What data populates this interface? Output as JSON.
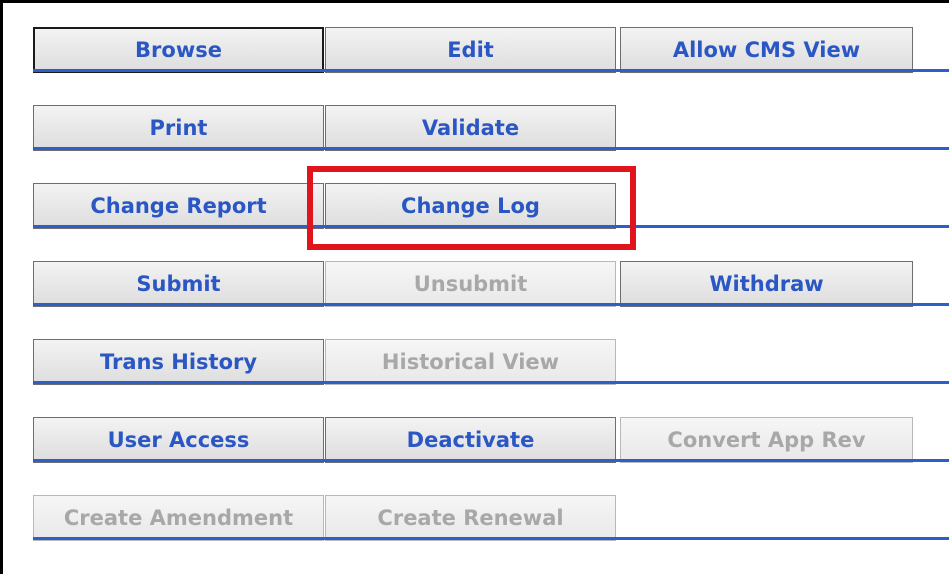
{
  "rows": [
    {
      "buttons": [
        "Browse",
        "Edit",
        "Allow CMS View"
      ]
    },
    {
      "buttons": [
        "Print",
        "Validate"
      ]
    },
    {
      "buttons": [
        "Change Report",
        "Change Log"
      ]
    },
    {
      "buttons": [
        "Submit",
        "Unsubmit",
        "Withdraw"
      ]
    },
    {
      "buttons": [
        "Trans History",
        "Historical View"
      ]
    },
    {
      "buttons": [
        "User Access",
        "Deactivate",
        "Convert App Rev"
      ]
    },
    {
      "buttons": [
        "Create Amendment",
        "Create Renewal"
      ]
    }
  ],
  "disabled_buttons": [
    "Unsubmit",
    "Historical View",
    "Convert App Rev",
    "Create Amendment",
    "Create Renewal"
  ],
  "highlighted_button": "Change Log",
  "colors": {
    "button_text": "#2a57c3",
    "disabled_text": "#a8a8a8",
    "row_divider": "#2e5ec9",
    "highlight_box": "#e0141c"
  }
}
